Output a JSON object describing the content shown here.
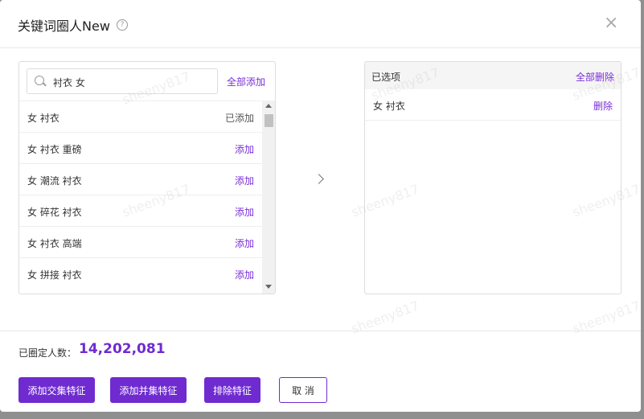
{
  "dialog": {
    "title": "关键词圈人New",
    "help_icon": "?",
    "close_icon": "×"
  },
  "search": {
    "value": "衬衣 女",
    "add_all_label": "全部添加"
  },
  "results": [
    {
      "keyword": "女 衬衣",
      "action": "已添加",
      "added": true
    },
    {
      "keyword": "女 衬衣 重磅",
      "action": "添加",
      "added": false
    },
    {
      "keyword": "女 潮流 衬衣",
      "action": "添加",
      "added": false
    },
    {
      "keyword": "女 碎花 衬衣",
      "action": "添加",
      "added": false
    },
    {
      "keyword": "女 衬衣 高端",
      "action": "添加",
      "added": false
    },
    {
      "keyword": "女 拼接 衬衣",
      "action": "添加",
      "added": false
    }
  ],
  "selected_panel": {
    "title": "已选项",
    "clear_all_label": "全部删除",
    "items": [
      {
        "keyword": "女 衬衣",
        "delete_label": "删除"
      }
    ]
  },
  "summary": {
    "label": "已圈定人数：",
    "value": "14,202,081"
  },
  "buttons": {
    "intersect": "添加交集特征",
    "union": "添加并集特征",
    "exclude": "排除特征",
    "cancel": "取 消"
  },
  "watermark": "sheeny817",
  "colors": {
    "accent": "#6f2bd0",
    "link": "#7a2fd6"
  }
}
